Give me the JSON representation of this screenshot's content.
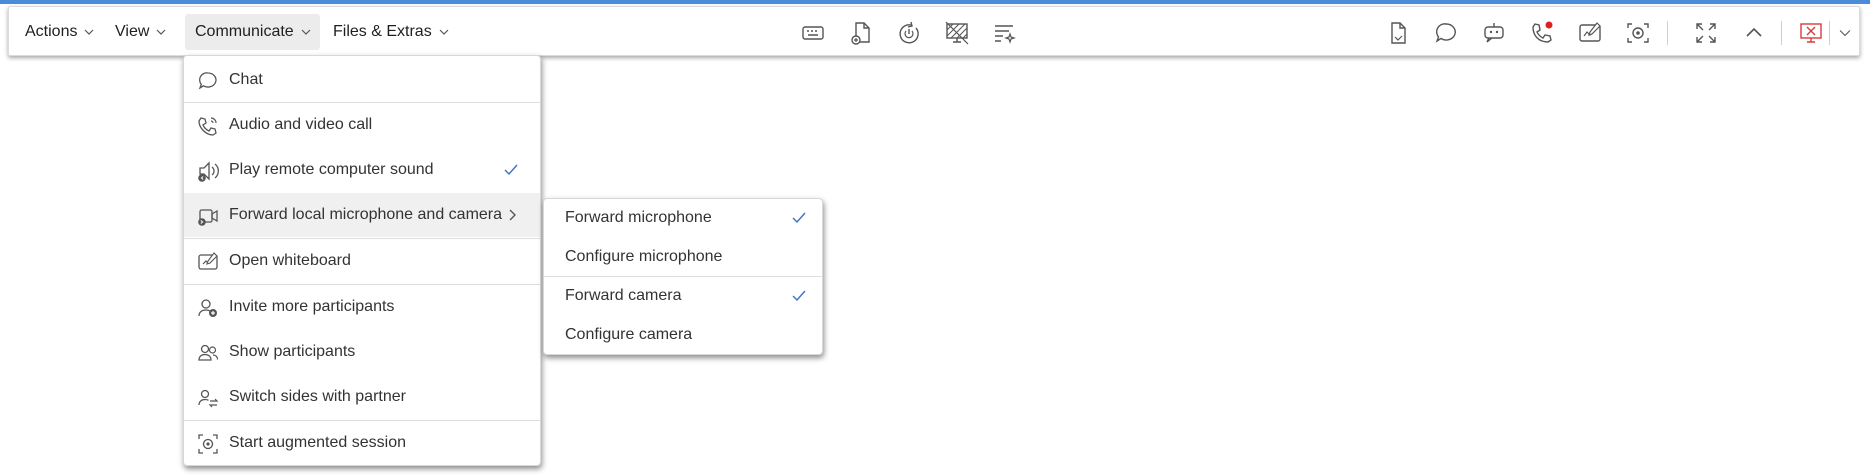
{
  "menubar": {
    "actions": "Actions",
    "view": "View",
    "communicate": "Communicate",
    "files_extras": "Files & Extras"
  },
  "communicate_menu": {
    "items": [
      {
        "label": "Chat",
        "icon": "chat-icon"
      },
      {
        "label": "Audio and video call",
        "icon": "phone-icon"
      },
      {
        "label": "Play remote computer sound",
        "icon": "speaker-icon",
        "checked": true
      },
      {
        "label": "Forward local microphone and camera",
        "icon": "camera-icon",
        "submenu": true
      },
      {
        "label": "Open whiteboard",
        "icon": "whiteboard-icon"
      },
      {
        "label": "Invite more participants",
        "icon": "add-user-icon"
      },
      {
        "label": "Show participants",
        "icon": "participants-icon"
      },
      {
        "label": "Switch sides with partner",
        "icon": "switch-sides-icon"
      },
      {
        "label": "Start augmented session",
        "icon": "augmented-icon"
      }
    ]
  },
  "forward_submenu": {
    "items": [
      {
        "label": "Forward microphone",
        "checked": true
      },
      {
        "label": "Configure microphone"
      },
      {
        "label": "Forward camera",
        "checked": true
      },
      {
        "label": "Configure camera"
      }
    ]
  },
  "colors": {
    "accent": "#4a8cd8",
    "check": "#3b6fd0",
    "close_red": "#d83b3b",
    "notification_dot": "#e02020"
  }
}
